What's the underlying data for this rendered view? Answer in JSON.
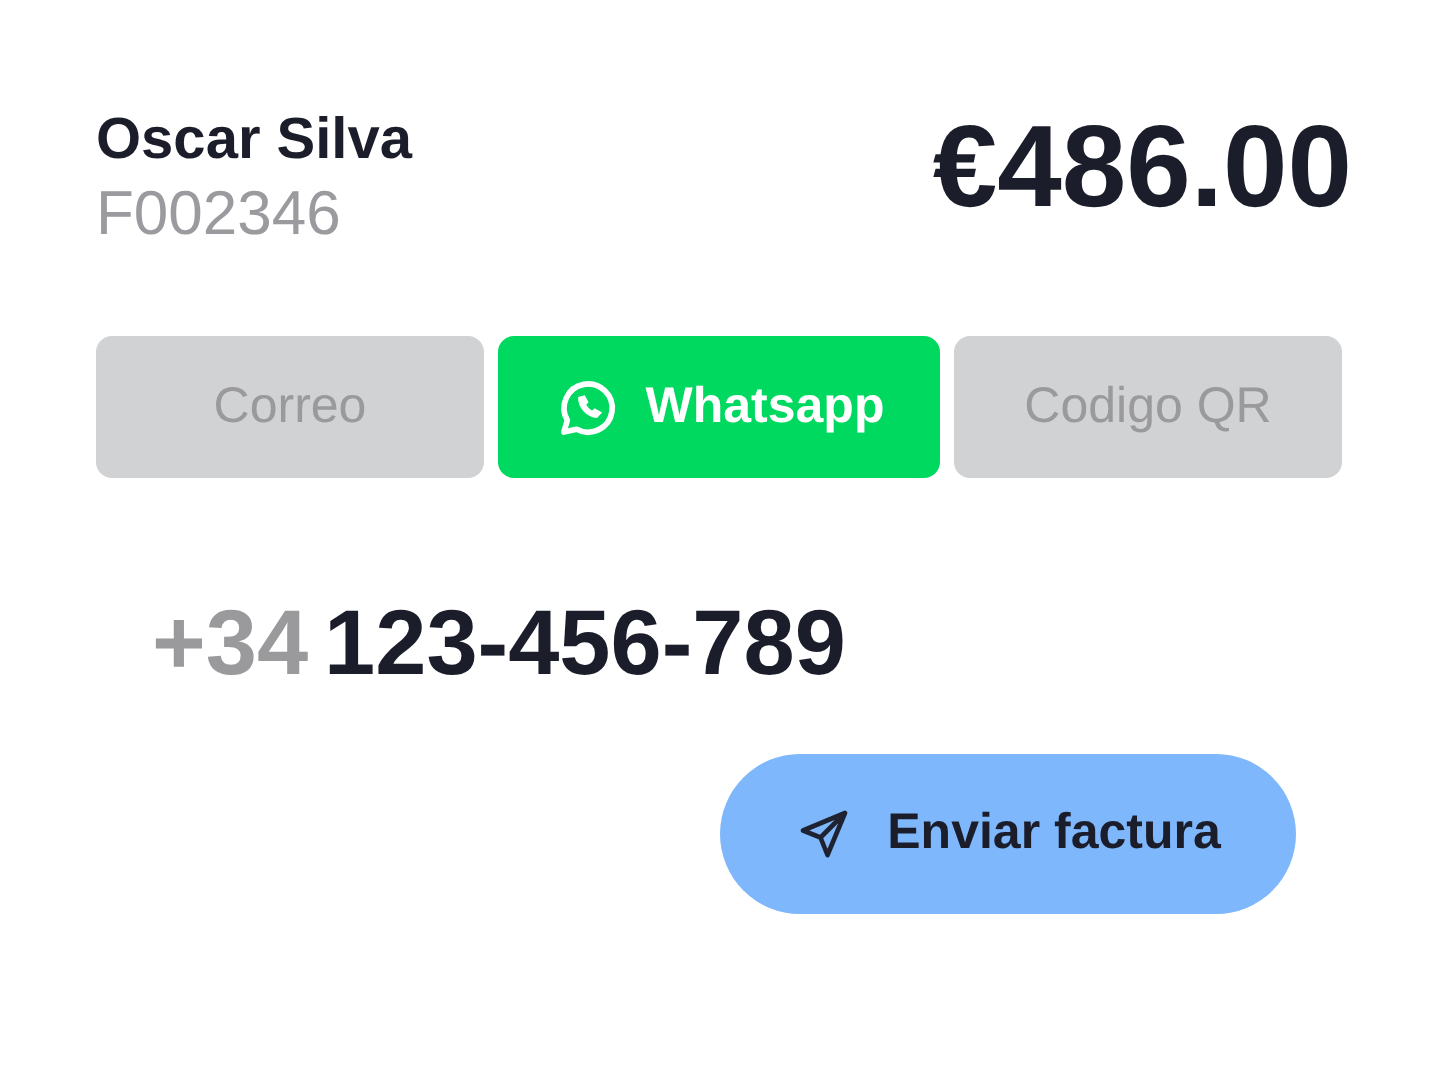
{
  "customer": {
    "name": "Oscar Silva",
    "invoice_id": "F002346"
  },
  "amount": "€486.00",
  "tabs": [
    {
      "label": "Correo",
      "selected": false,
      "kind": "text"
    },
    {
      "label": "Whatsapp",
      "selected": true,
      "kind": "icon"
    },
    {
      "label": "Codigo QR",
      "selected": false,
      "kind": "text"
    }
  ],
  "phone": {
    "prefix": "+34",
    "number": "123-456-789"
  },
  "send_button": {
    "label": "Enviar factura"
  }
}
